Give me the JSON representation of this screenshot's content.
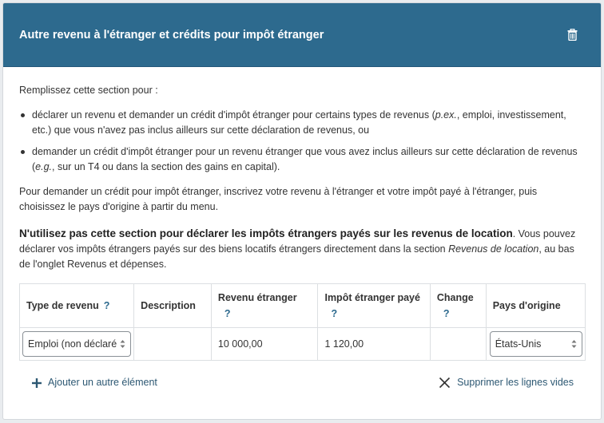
{
  "header": {
    "title": "Autre revenu à l'étranger et crédits pour impôt étranger",
    "delete_icon": "trash-icon"
  },
  "intro": "Remplissez cette section pour :",
  "bullets": {
    "b1_a": "déclarer un revenu et demander un crédit d'impôt étranger pour certains types de revenus (",
    "b1_em": "p.ex.",
    "b1_b": ", emploi, investissement, etc.) que vous n'avez pas inclus ailleurs sur cette déclaration de revenus, ou",
    "b2_a": "demander un crédit d'impôt étranger pour un revenu étranger que vous avez inclus ailleurs sur cette déclaration de revenus (",
    "b2_em": "e.g.",
    "b2_b": ", sur un T4 ou dans la section des gains en capital)."
  },
  "instruction": "Pour demander un crédit pour impôt étranger, inscrivez votre revenu à l'étranger et votre impôt payé à l'étranger, puis choisissez le pays d'origine à partir du menu.",
  "warning": {
    "bold": "N'utilisez pas cette section pour déclarer les impôts étrangers payés sur les revenus de location",
    "text_a": ". Vous pouvez déclarer vos impôts étrangers payés sur des biens locatifs étrangers directement dans la section ",
    "em": "Revenus de location",
    "text_b": ", au bas de l'onglet Revenus et dépenses."
  },
  "table": {
    "headers": {
      "type": "Type de revenu",
      "description": "Description",
      "income": "Revenu étranger",
      "tax": "Impôt étranger payé",
      "exchange": "Change",
      "country": "Pays d'origine",
      "help": "?"
    },
    "row": {
      "type": "Emploi (non déclaré",
      "description": "",
      "income": "10 000,00",
      "tax": "1 120,00",
      "exchange": "",
      "country": "États-Unis"
    }
  },
  "footer": {
    "add": "Ajouter un autre élément",
    "remove": "Supprimer les lignes vides"
  },
  "colors": {
    "header_bg": "#2d6a8e",
    "link": "#2d5873"
  }
}
